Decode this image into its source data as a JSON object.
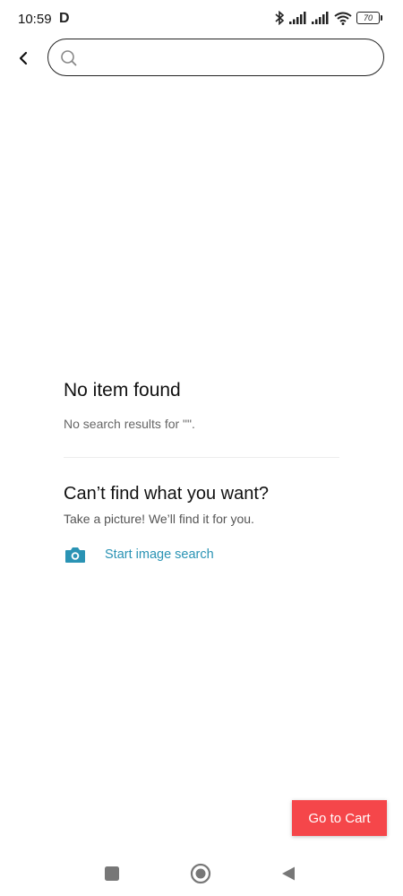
{
  "status_bar": {
    "time": "10:59",
    "carrier_badge": "D",
    "battery_level": "70",
    "icons": [
      "bluetooth-icon",
      "signal-icon",
      "signal-icon",
      "wifi-icon",
      "battery-icon"
    ]
  },
  "search": {
    "value": "",
    "placeholder": ""
  },
  "empty_state": {
    "title": "No item found",
    "message": "No search results for \"\"."
  },
  "suggestion": {
    "title": "Can’t find what you want?",
    "subtitle": "Take a picture! We’ll find it for you.",
    "action_label": "Start image search",
    "action_color": "#2a93b4"
  },
  "cart_button": {
    "label": "Go to Cart",
    "color": "#f5464a"
  },
  "nav_bar": {
    "buttons": [
      "square-recents-icon",
      "circle-home-icon",
      "triangle-back-icon"
    ]
  }
}
